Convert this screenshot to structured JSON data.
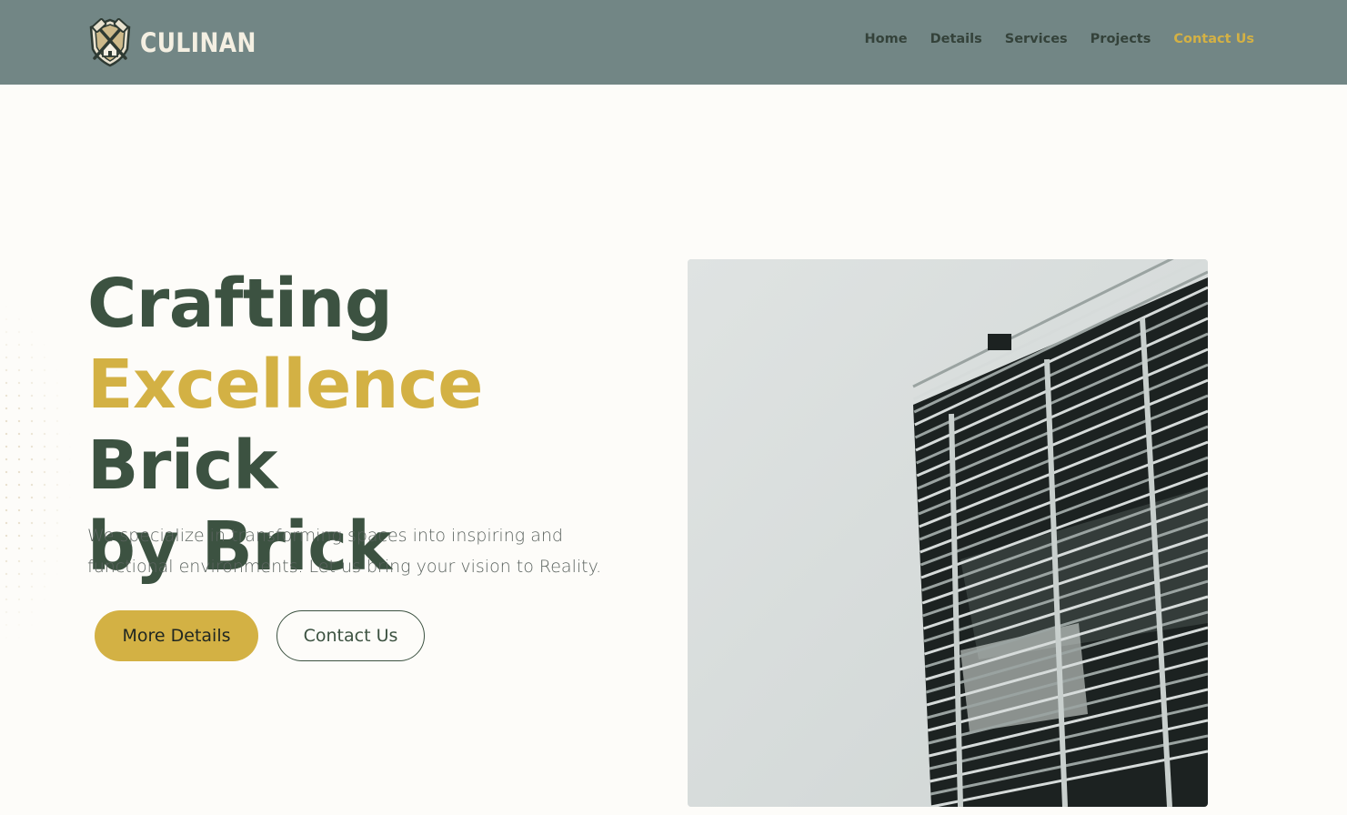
{
  "brand": {
    "name": "CULINAN"
  },
  "nav": {
    "items": [
      {
        "label": "Home"
      },
      {
        "label": "Details"
      },
      {
        "label": "Services"
      },
      {
        "label": "Projects"
      },
      {
        "label": "Contact Us",
        "active": true
      }
    ]
  },
  "hero": {
    "title_line1": "Crafting",
    "title_accent": "Excellence",
    "title_rest": " Brick",
    "title_line3": "by Brick",
    "subtitle": "We specialize in transforming spaces into inspiring and functional environments. Let us bring your vision to Reality.",
    "primary_button": "More Details",
    "secondary_button": "Contact Us"
  },
  "colors": {
    "header_bg": "#728685",
    "accent": "#d3b144",
    "heading": "#3c5241",
    "page_bg": "#fdfcf9"
  }
}
